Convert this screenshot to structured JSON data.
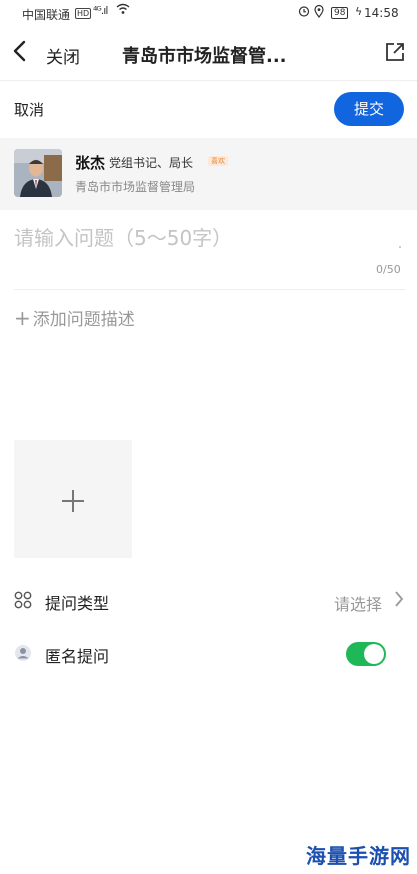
{
  "status_bar": {
    "carrier": "中国联通",
    "hd": "HD",
    "signal": "⁴ᴳ.ıl",
    "battery": "98",
    "time": "14:58"
  },
  "nav": {
    "close_label": "关闭",
    "title": "青岛市市场监督管..."
  },
  "actions": {
    "cancel_label": "取消",
    "submit_label": "提交"
  },
  "target": {
    "name": "张杰",
    "role": "党组书记、局长",
    "tag": "喜欢",
    "org": "青岛市市场监督管理局"
  },
  "question": {
    "placeholder": "请输入问题（5〜50字）",
    "counter": "0/50"
  },
  "description": {
    "add_label": "添加问题描述"
  },
  "rows": {
    "type_label": "提问类型",
    "type_value": "请选择",
    "anon_label": "匿名提问",
    "anon_enabled": true
  },
  "watermark": "海量手游网",
  "colors": {
    "primary": "#1166e0",
    "toggle_on": "#1fb858",
    "placeholder": "#c4c4c4"
  }
}
